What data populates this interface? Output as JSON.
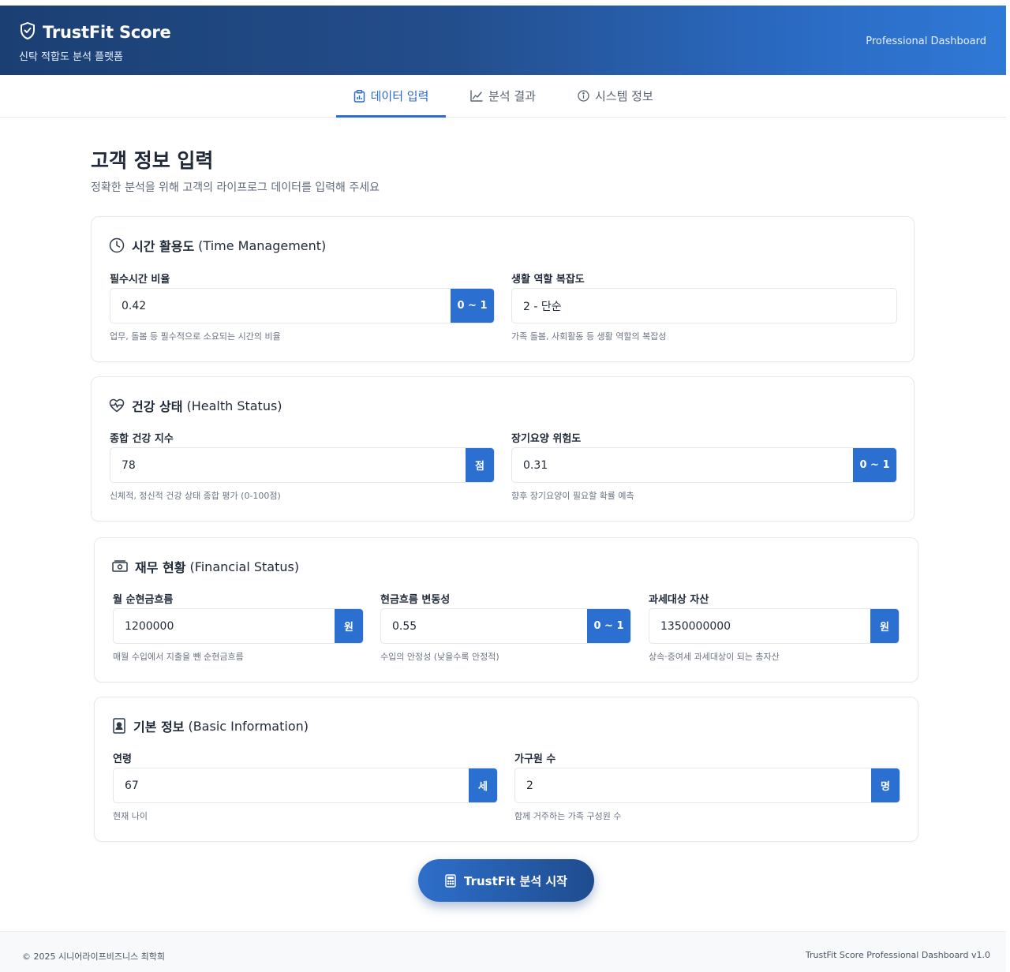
{
  "header": {
    "title": "TrustFit Score",
    "subtitle": "신탁 적합도 분석 플랫폼",
    "right_label": "Professional Dashboard"
  },
  "tabs": [
    {
      "label": "데이터 입력",
      "icon": "document-chart-icon",
      "active": true
    },
    {
      "label": "분석 결과",
      "icon": "line-chart-icon",
      "active": false
    },
    {
      "label": "시스템 정보",
      "icon": "info-icon",
      "active": false
    }
  ],
  "page": {
    "title": "고객 정보 입력",
    "subtitle": "정확한 분석을 위해 고객의 라이프로그 데이터를 입력해 주세요"
  },
  "sections": {
    "time": {
      "title": "시간 활용도",
      "title_en": "(Time Management)",
      "icon": "clock-icon",
      "fields": [
        {
          "label": "필수시간 비율",
          "value": "0.42",
          "unit": "0 ~ 1",
          "hint": "업무, 돌봄 등 필수적으로 소요되는 시간의 비율"
        },
        {
          "label": "생활 역할 복잡도",
          "value": "2 - 단순",
          "unit": "",
          "hint": "가족 돌봄, 사회활동 등 생활 역할의 복잡성"
        }
      ]
    },
    "health": {
      "title": "건강 상태",
      "title_en": "(Health Status)",
      "icon": "heart-pulse-icon",
      "fields": [
        {
          "label": "종합 건강 지수",
          "value": "78",
          "unit": "점",
          "hint": "신체적, 정신적 건강 상태 종합 평가 (0-100점)"
        },
        {
          "label": "장기요양 위험도",
          "value": "0.31",
          "unit": "0 ~ 1",
          "hint": "향후 장기요양이 필요할 확률 예측"
        }
      ]
    },
    "finance": {
      "title": "재무 현황",
      "title_en": "(Financial Status)",
      "icon": "money-icon",
      "fields": [
        {
          "label": "월 순현금흐름",
          "value": "1200000",
          "unit": "원",
          "hint": "매월 수입에서 지출을 뺀 순현금흐름"
        },
        {
          "label": "현금흐름 변동성",
          "value": "0.55",
          "unit": "0 ~ 1",
          "hint": "수입의 안정성 (낮을수록 안정적)"
        },
        {
          "label": "과세대상 자산",
          "value": "1350000000",
          "unit": "원",
          "hint": "상속·증여세 과세대상이 되는 총자산"
        }
      ]
    },
    "basic": {
      "title": "기본 정보",
      "title_en": "(Basic Information)",
      "icon": "id-badge-icon",
      "fields": [
        {
          "label": "연령",
          "value": "67",
          "unit": "세",
          "hint": "현재 나이"
        },
        {
          "label": "가구원 수",
          "value": "2",
          "unit": "명",
          "hint": "함께 거주하는 가족 구성원 수"
        }
      ]
    }
  },
  "cta": {
    "label": "TrustFit 분석 시작",
    "icon": "calculator-icon"
  },
  "footer": {
    "left": "© 2025 시니어라이프비즈니스 최학희",
    "right": "TrustFit Score Professional Dashboard v1.0"
  },
  "colors": {
    "accent": "#2b6fd1",
    "header_start": "#1b3f73",
    "header_end": "#2f79d6"
  }
}
